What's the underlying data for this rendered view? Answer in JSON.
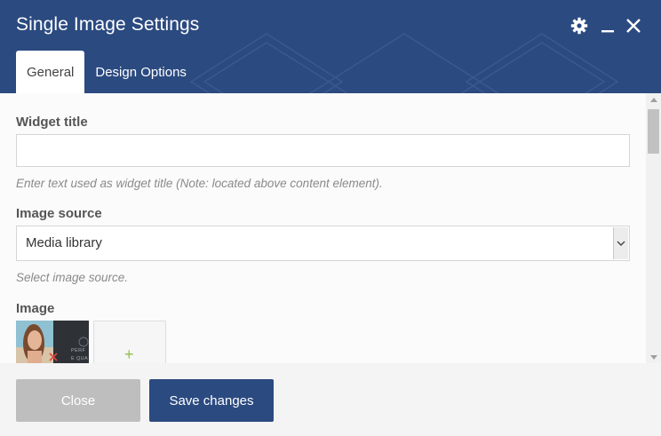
{
  "dialog": {
    "title": "Single Image Settings",
    "icons": {
      "settings": "gear-icon",
      "minimize": "minimize-icon",
      "close": "close-icon"
    }
  },
  "tabs": [
    {
      "label": "General",
      "active": true
    },
    {
      "label": "Design Options",
      "active": false
    }
  ],
  "form": {
    "widget_title": {
      "label": "Widget title",
      "value": "",
      "help": "Enter text used as widget title (Note: located above content element)."
    },
    "image_source": {
      "label": "Image source",
      "value": "Media library",
      "help": "Select image source."
    },
    "image": {
      "label": "Image",
      "thumbnail_text": "PERFE QUAL",
      "add_symbol": "+"
    }
  },
  "footer": {
    "close_label": "Close",
    "save_label": "Save changes"
  },
  "colors": {
    "header": "#2b4a80",
    "primary_button": "#2b4a80",
    "close_button": "#bebebe",
    "add_plus": "#8bc34a",
    "remove_x": "#e0483f"
  }
}
